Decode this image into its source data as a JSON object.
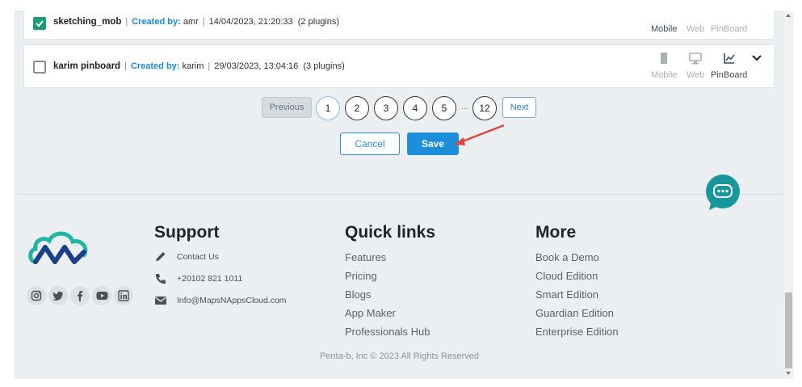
{
  "projects": [
    {
      "name": "sketching_mob",
      "created_by_label": "Created by:",
      "author": "amr",
      "date": "14/04/2023, 21:20:33",
      "plugins": "(2 plugins)",
      "checked": true,
      "platforms": [
        {
          "label": "Mobile",
          "active": true
        },
        {
          "label": "Web",
          "active": false
        },
        {
          "label": "PinBoard",
          "active": false
        }
      ]
    },
    {
      "name": "karim pinboard",
      "created_by_label": "Created by:",
      "author": "karim",
      "date": "29/03/2023, 13:04:16",
      "plugins": "(3 plugins)",
      "checked": false,
      "platforms": [
        {
          "label": "Mobile",
          "active": false
        },
        {
          "label": "Web",
          "active": false
        },
        {
          "label": "PinBoard",
          "active": true
        }
      ]
    }
  ],
  "pagination": {
    "previous_label": "Previous",
    "next_label": "Next",
    "pages": [
      "1",
      "2",
      "3",
      "4",
      "5",
      "12"
    ],
    "ellipsis": "...",
    "current": "1"
  },
  "actions": {
    "cancel_label": "Cancel",
    "save_label": "Save"
  },
  "footer": {
    "support": {
      "title": "Support",
      "items": [
        {
          "icon": "pencil-icon",
          "text": "Contact Us"
        },
        {
          "icon": "phone-icon",
          "text": "+20102 821 1011"
        },
        {
          "icon": "envelope-icon",
          "text": "Info@MapsNAppsCloud.com"
        }
      ]
    },
    "quick_links": {
      "title": "Quick links",
      "items": [
        "Features",
        "Pricing",
        "Blogs",
        "App Maker",
        "Professionals Hub"
      ]
    },
    "more": {
      "title": "More",
      "items": [
        "Book a Demo",
        "Cloud Edition",
        "Smart Edition",
        "Guardian Edition",
        "Enterprise Edition"
      ]
    },
    "socials": [
      "instagram-icon",
      "twitter-icon",
      "facebook-icon",
      "youtube-icon",
      "linkedin-icon"
    ],
    "copyright": "Penta-b, Inc © 2023 All Rights Reserved"
  },
  "colors": {
    "accent": "#1d8ed9",
    "checkbox": "#1b9c77",
    "chat": "#17979b",
    "arrow": "#e0443f"
  }
}
